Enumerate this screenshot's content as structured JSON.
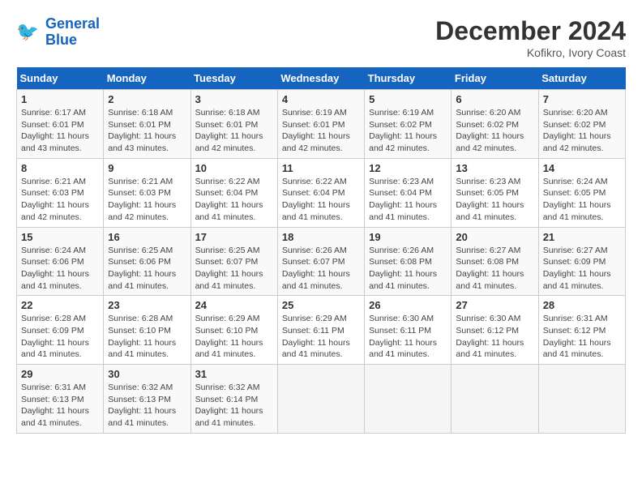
{
  "header": {
    "logo_line1": "General",
    "logo_line2": "Blue",
    "month_year": "December 2024",
    "location": "Kofikro, Ivory Coast"
  },
  "weekdays": [
    "Sunday",
    "Monday",
    "Tuesday",
    "Wednesday",
    "Thursday",
    "Friday",
    "Saturday"
  ],
  "weeks": [
    [
      {
        "day": "1",
        "detail": "Sunrise: 6:17 AM\nSunset: 6:01 PM\nDaylight: 11 hours\nand 43 minutes."
      },
      {
        "day": "2",
        "detail": "Sunrise: 6:18 AM\nSunset: 6:01 PM\nDaylight: 11 hours\nand 43 minutes."
      },
      {
        "day": "3",
        "detail": "Sunrise: 6:18 AM\nSunset: 6:01 PM\nDaylight: 11 hours\nand 42 minutes."
      },
      {
        "day": "4",
        "detail": "Sunrise: 6:19 AM\nSunset: 6:01 PM\nDaylight: 11 hours\nand 42 minutes."
      },
      {
        "day": "5",
        "detail": "Sunrise: 6:19 AM\nSunset: 6:02 PM\nDaylight: 11 hours\nand 42 minutes."
      },
      {
        "day": "6",
        "detail": "Sunrise: 6:20 AM\nSunset: 6:02 PM\nDaylight: 11 hours\nand 42 minutes."
      },
      {
        "day": "7",
        "detail": "Sunrise: 6:20 AM\nSunset: 6:02 PM\nDaylight: 11 hours\nand 42 minutes."
      }
    ],
    [
      {
        "day": "8",
        "detail": "Sunrise: 6:21 AM\nSunset: 6:03 PM\nDaylight: 11 hours\nand 42 minutes."
      },
      {
        "day": "9",
        "detail": "Sunrise: 6:21 AM\nSunset: 6:03 PM\nDaylight: 11 hours\nand 42 minutes."
      },
      {
        "day": "10",
        "detail": "Sunrise: 6:22 AM\nSunset: 6:04 PM\nDaylight: 11 hours\nand 41 minutes."
      },
      {
        "day": "11",
        "detail": "Sunrise: 6:22 AM\nSunset: 6:04 PM\nDaylight: 11 hours\nand 41 minutes."
      },
      {
        "day": "12",
        "detail": "Sunrise: 6:23 AM\nSunset: 6:04 PM\nDaylight: 11 hours\nand 41 minutes."
      },
      {
        "day": "13",
        "detail": "Sunrise: 6:23 AM\nSunset: 6:05 PM\nDaylight: 11 hours\nand 41 minutes."
      },
      {
        "day": "14",
        "detail": "Sunrise: 6:24 AM\nSunset: 6:05 PM\nDaylight: 11 hours\nand 41 minutes."
      }
    ],
    [
      {
        "day": "15",
        "detail": "Sunrise: 6:24 AM\nSunset: 6:06 PM\nDaylight: 11 hours\nand 41 minutes."
      },
      {
        "day": "16",
        "detail": "Sunrise: 6:25 AM\nSunset: 6:06 PM\nDaylight: 11 hours\nand 41 minutes."
      },
      {
        "day": "17",
        "detail": "Sunrise: 6:25 AM\nSunset: 6:07 PM\nDaylight: 11 hours\nand 41 minutes."
      },
      {
        "day": "18",
        "detail": "Sunrise: 6:26 AM\nSunset: 6:07 PM\nDaylight: 11 hours\nand 41 minutes."
      },
      {
        "day": "19",
        "detail": "Sunrise: 6:26 AM\nSunset: 6:08 PM\nDaylight: 11 hours\nand 41 minutes."
      },
      {
        "day": "20",
        "detail": "Sunrise: 6:27 AM\nSunset: 6:08 PM\nDaylight: 11 hours\nand 41 minutes."
      },
      {
        "day": "21",
        "detail": "Sunrise: 6:27 AM\nSunset: 6:09 PM\nDaylight: 11 hours\nand 41 minutes."
      }
    ],
    [
      {
        "day": "22",
        "detail": "Sunrise: 6:28 AM\nSunset: 6:09 PM\nDaylight: 11 hours\nand 41 minutes."
      },
      {
        "day": "23",
        "detail": "Sunrise: 6:28 AM\nSunset: 6:10 PM\nDaylight: 11 hours\nand 41 minutes."
      },
      {
        "day": "24",
        "detail": "Sunrise: 6:29 AM\nSunset: 6:10 PM\nDaylight: 11 hours\nand 41 minutes."
      },
      {
        "day": "25",
        "detail": "Sunrise: 6:29 AM\nSunset: 6:11 PM\nDaylight: 11 hours\nand 41 minutes."
      },
      {
        "day": "26",
        "detail": "Sunrise: 6:30 AM\nSunset: 6:11 PM\nDaylight: 11 hours\nand 41 minutes."
      },
      {
        "day": "27",
        "detail": "Sunrise: 6:30 AM\nSunset: 6:12 PM\nDaylight: 11 hours\nand 41 minutes."
      },
      {
        "day": "28",
        "detail": "Sunrise: 6:31 AM\nSunset: 6:12 PM\nDaylight: 11 hours\nand 41 minutes."
      }
    ],
    [
      {
        "day": "29",
        "detail": "Sunrise: 6:31 AM\nSunset: 6:13 PM\nDaylight: 11 hours\nand 41 minutes."
      },
      {
        "day": "30",
        "detail": "Sunrise: 6:32 AM\nSunset: 6:13 PM\nDaylight: 11 hours\nand 41 minutes."
      },
      {
        "day": "31",
        "detail": "Sunrise: 6:32 AM\nSunset: 6:14 PM\nDaylight: 11 hours\nand 41 minutes."
      },
      {
        "day": "",
        "detail": ""
      },
      {
        "day": "",
        "detail": ""
      },
      {
        "day": "",
        "detail": ""
      },
      {
        "day": "",
        "detail": ""
      }
    ]
  ]
}
